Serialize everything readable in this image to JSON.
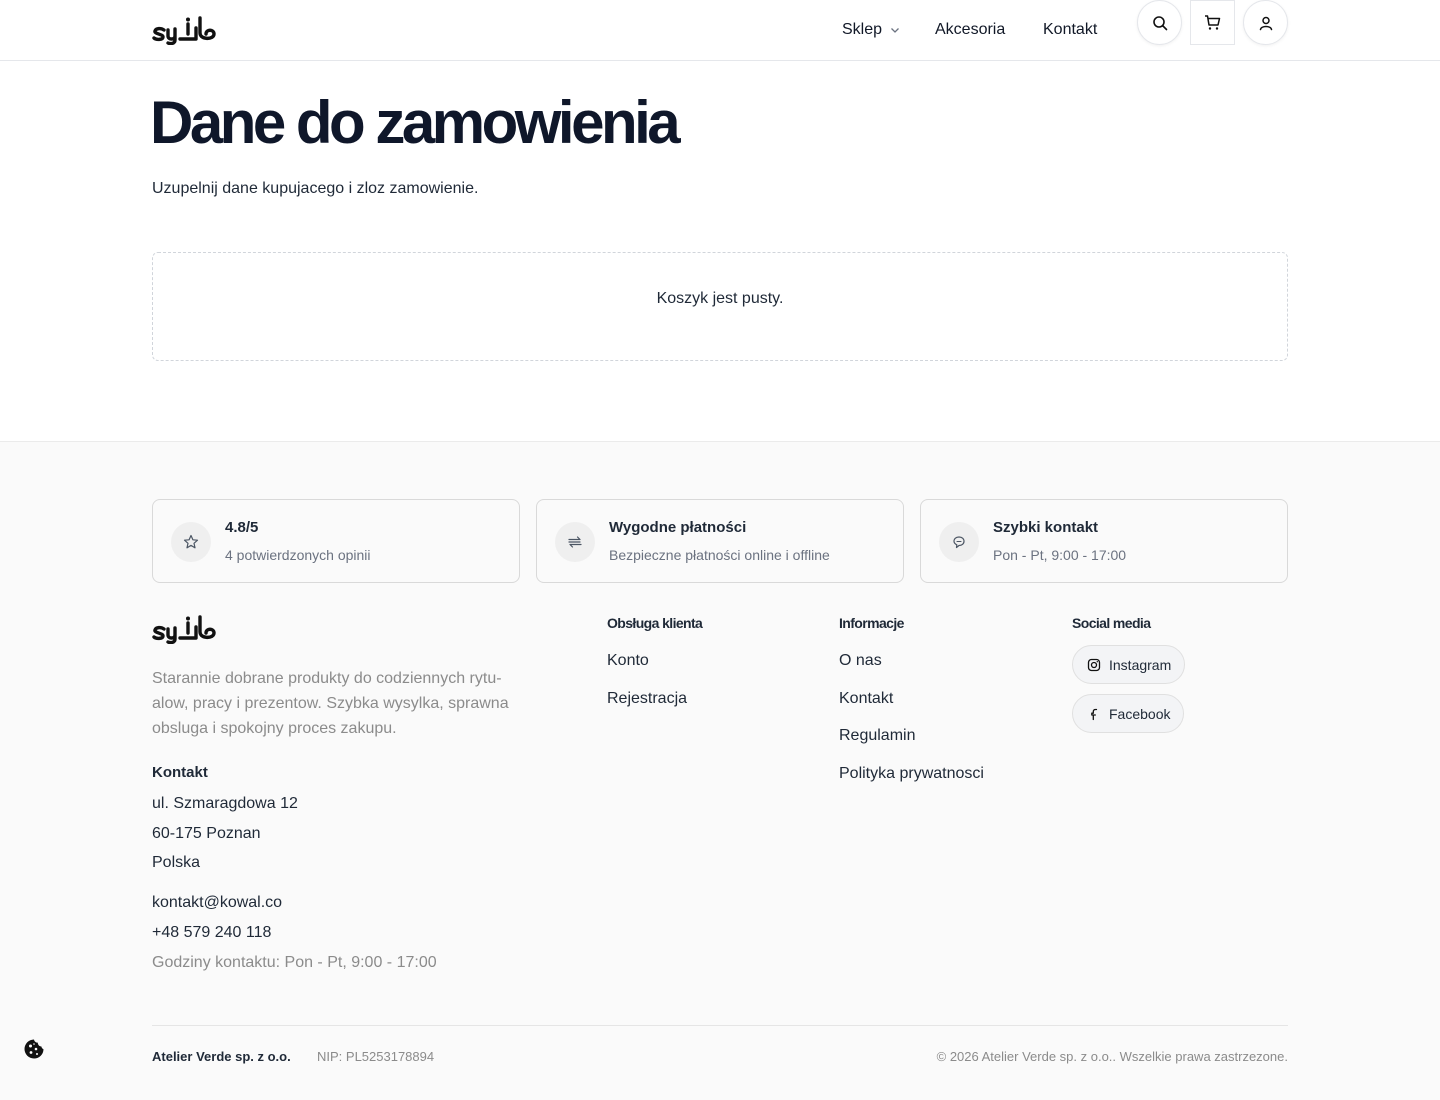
{
  "header": {
    "nav": {
      "sklep": "Sklep",
      "akcesoria": "Akcesoria",
      "kontakt": "Kontakt"
    },
    "icons": [
      "search-icon",
      "cart-icon",
      "user-icon",
      "chevron-down-icon"
    ]
  },
  "main": {
    "title": "Dane do zamowienia",
    "subtitle": "Uzupelnij dane kupujacego i zloz zamowienie.",
    "empty_cart": "Koszyk jest pusty."
  },
  "footer": {
    "features": [
      {
        "icon": "star-icon",
        "title": "4.8/5",
        "subtitle": "4 potwierdzonych opinii"
      },
      {
        "icon": "arrows-icon",
        "title": "Wygodne płatności",
        "subtitle": "Bezpieczne płatności online i offline"
      },
      {
        "icon": "chat-icon",
        "title": "Szybki kontakt",
        "subtitle": "Pon - Pt, 9:00 - 17:00"
      }
    ],
    "description": "Starannie dobrane produkty do codziennych rytu-alow, pracy i prezentow. Szybka wysylka, sprawna obsluga i spokojny proces zakupu.",
    "contact": {
      "heading": "Kontakt",
      "street": "ul. Szmaragdowa 12",
      "city": "60-175 Poznan",
      "country": "Polska",
      "email": "kontakt@kowal.co",
      "phone": "+48 579 240 118",
      "hours": "Godziny kontaktu: Pon - Pt, 9:00 - 17:00"
    },
    "columns": {
      "service": {
        "heading": "Obsługa klienta",
        "links": [
          "Konto",
          "Rejestracja"
        ]
      },
      "info": {
        "heading": "Informacje",
        "links": [
          "O nas",
          "Kontakt",
          "Regulamin",
          "Polityka prywatnosci"
        ]
      },
      "social": {
        "heading": "Social media",
        "links": [
          "Instagram",
          "Facebook"
        ]
      }
    },
    "bottom": {
      "company": "Atelier Verde sp. z o.o.",
      "nip": "NIP: PL5253178894",
      "copyright": "© 2026 Atelier Verde sp. z o.o.. Wszelkie prawa zastrzezone."
    }
  },
  "colors": {
    "text": "#111827",
    "muted": "#8b8b8b",
    "footer_bg": "#fafafa",
    "border": "#e5e7eb"
  }
}
